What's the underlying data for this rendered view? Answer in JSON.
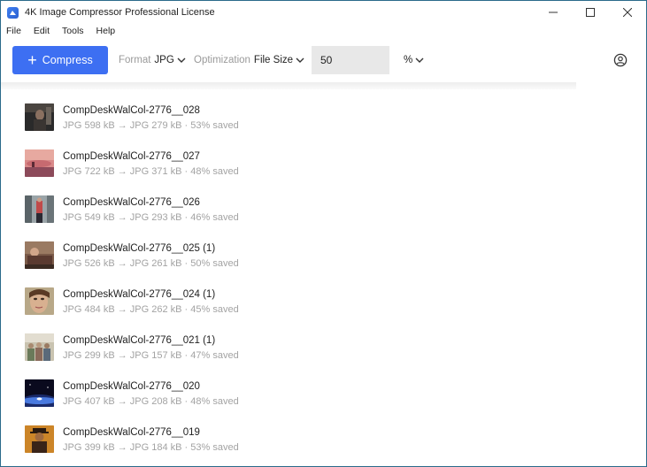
{
  "window": {
    "title": "4K Image Compressor Professional License",
    "controls": [
      "minimize-icon",
      "maximize-icon",
      "close-icon"
    ]
  },
  "menu": {
    "items": [
      {
        "label": "File"
      },
      {
        "label": "Edit"
      },
      {
        "label": "Tools"
      },
      {
        "label": "Help"
      }
    ]
  },
  "toolbar": {
    "compress_label": "Compress",
    "compress_color": "#3d6ff2",
    "format_label": "Format",
    "format_value": "JPG",
    "optimization_label": "Optimization",
    "optimization_value": "File Size",
    "quality_value": "50",
    "unit_value": "%",
    "account_icon": "account-icon"
  },
  "files": [
    {
      "name": "CompDeskWalCol-2776__028",
      "details": "JPG 598 kB → JPG 279 kB · 53% saved",
      "thumb": "dark-portrait"
    },
    {
      "name": "CompDeskWalCol-2776__027",
      "details": "JPG 722 kB → JPG 371 kB · 48% saved",
      "thumb": "pink-sunset"
    },
    {
      "name": "CompDeskWalCol-2776__026",
      "details": "JPG 549 kB → JPG 293 kB · 46% saved",
      "thumb": "street-scene"
    },
    {
      "name": "CompDeskWalCol-2776__025 (1)",
      "details": "JPG 526 kB → JPG 261 kB · 50% saved",
      "thumb": "woman-lying"
    },
    {
      "name": "CompDeskWalCol-2776__024 (1)",
      "details": "JPG 484 kB → JPG 262 kB · 45% saved",
      "thumb": "woman-face"
    },
    {
      "name": "CompDeskWalCol-2776__021 (1)",
      "details": "JPG 299 kB → JPG 157 kB · 47% saved",
      "thumb": "group-outdoor"
    },
    {
      "name": "CompDeskWalCol-2776__020",
      "details": "JPG 407 kB → JPG 208 kB · 48% saved",
      "thumb": "planet-horizon"
    },
    {
      "name": "CompDeskWalCol-2776__019",
      "details": "JPG 399 kB → JPG 184 kB · 53% saved",
      "thumb": "man-with-hat"
    }
  ]
}
